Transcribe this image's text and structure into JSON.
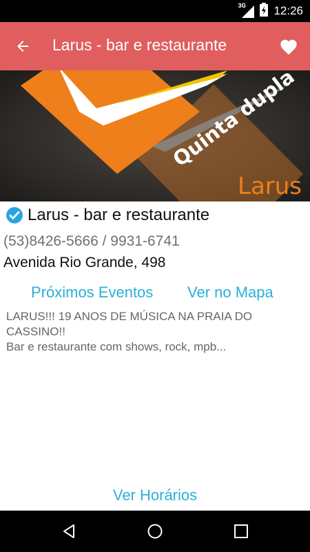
{
  "status_bar": {
    "network": "3G",
    "time": "12:26"
  },
  "app_bar": {
    "title": "Larus - bar e restaurante",
    "back_icon": "arrow-back-icon",
    "favorite_icon": "heart-icon"
  },
  "hero": {
    "overlay_text": "Quinta dupla",
    "brand_text": "Larus"
  },
  "venue": {
    "name": "Larus - bar e restaurante",
    "verified_icon": "verified-check-icon",
    "phones": "(53)8426-5666 / 9931-6741",
    "address": "Avenida Rio Grande, 498"
  },
  "actions": {
    "events_label": "Próximos Eventos",
    "map_label": "Ver no Mapa",
    "hours_label": "Ver Horários"
  },
  "description": {
    "line1": "LARUS!!! 19 ANOS DE MÚSICA NA PRAIA DO",
    "line2": "CASSINO!!",
    "line3": "Bar e restaurante com shows, rock, mpb..."
  },
  "colors": {
    "app_bar": "#e05e5e",
    "link": "#2bb0d9",
    "verified": "#2aa3e3"
  }
}
